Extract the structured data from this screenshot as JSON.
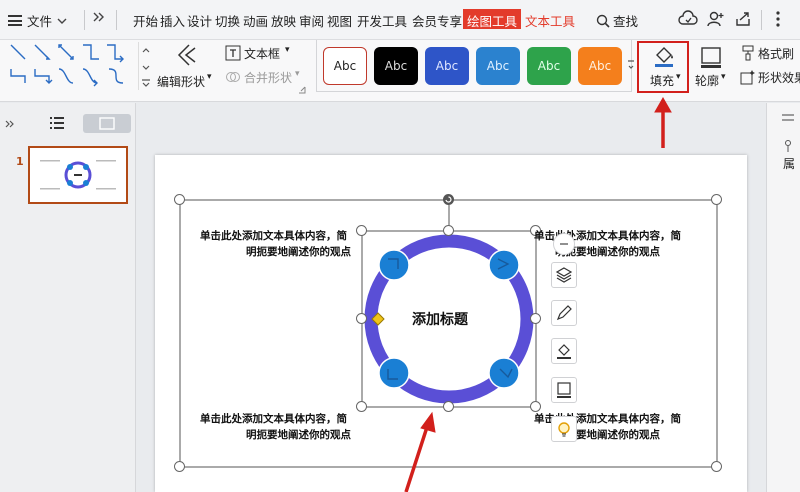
{
  "menubar": {
    "file_label": "文件",
    "tabs": [
      "开始",
      "插入",
      "设计",
      "切换",
      "动画",
      "放映",
      "审阅",
      "视图",
      "开发工具",
      "会员专享"
    ],
    "active_tab": "绘图工具",
    "context_tab": "文本工具",
    "search_label": "查找"
  },
  "ribbon": {
    "edit_shape_label": "编辑形状",
    "textbox_label": "文本框",
    "merge_shape_label": "合并形状",
    "swatch_text": "Abc",
    "swatch_colors": [
      "#ffffff",
      "#000000",
      "#2e55c8",
      "#2b82cf",
      "#2ea34b",
      "#f47f1c"
    ],
    "fill_label": "填充",
    "outline_label": "轮廓",
    "format_painter_label": "格式刷",
    "shape_effect_label": "形状效果"
  },
  "slides_panel": {
    "slide_number": "1"
  },
  "slide": {
    "title": "添加标题",
    "body_line1": "单击此处添加文本具体内容，简",
    "body_line2": "明扼要地阐述你的观点",
    "ring_color": "#5a4fd6",
    "node_color": "#1a7fd4"
  },
  "right_rail": {
    "label": "属"
  },
  "colors": {
    "accent_red": "#e33b2b",
    "highlight_red": "#d2201c"
  }
}
